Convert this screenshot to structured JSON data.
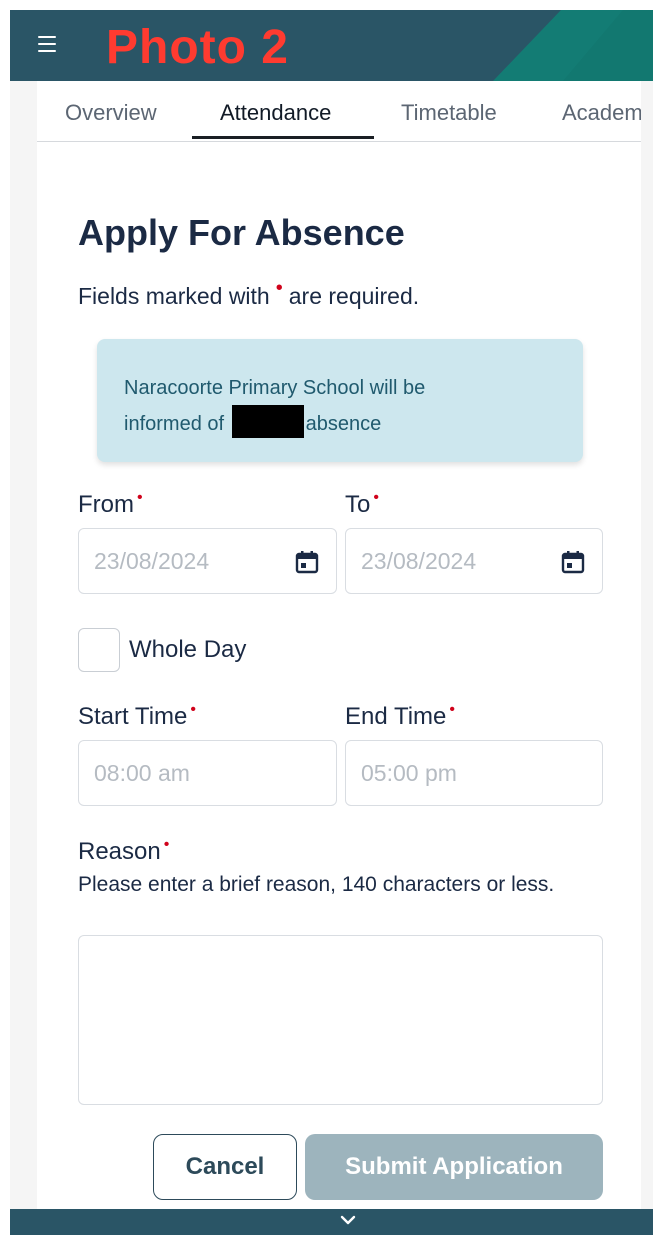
{
  "overlay_label": "Photo 2",
  "tabs": [
    {
      "label": "Overview"
    },
    {
      "label": "Attendance"
    },
    {
      "label": "Timetable"
    },
    {
      "label": "Academ"
    }
  ],
  "form": {
    "title": "Apply For Absence",
    "required_note_before": "Fields marked with",
    "required_marker": "•",
    "required_note_after": "are required.",
    "notice_line1": "Naracoorte Primary School will be",
    "notice_line2_before": "informed of",
    "notice_line2_after": "absence",
    "from_label": "From",
    "to_label": "To",
    "from_placeholder": "23/08/2024",
    "to_placeholder": "23/08/2024",
    "whole_day_label": "Whole Day",
    "whole_day_checked": false,
    "start_time_label": "Start Time",
    "end_time_label": "End Time",
    "start_time_placeholder": "08:00 am",
    "end_time_placeholder": "05:00 pm",
    "reason_label": "Reason",
    "reason_helper": "Please enter a brief reason, 140 characters or less.",
    "reason_value": "",
    "cancel_label": "Cancel",
    "submit_label": "Submit Application"
  },
  "icons": {
    "menu": "hamburger-icon",
    "calendar": "calendar-icon",
    "footer": "chevron-down-icon"
  },
  "colors": {
    "header": "#2a5566",
    "accent": "#137c74",
    "overlay_label": "#ff3b30",
    "required": "#d0021b",
    "notice_bg": "#cde7ee",
    "submit_disabled": "#9db4bd"
  }
}
